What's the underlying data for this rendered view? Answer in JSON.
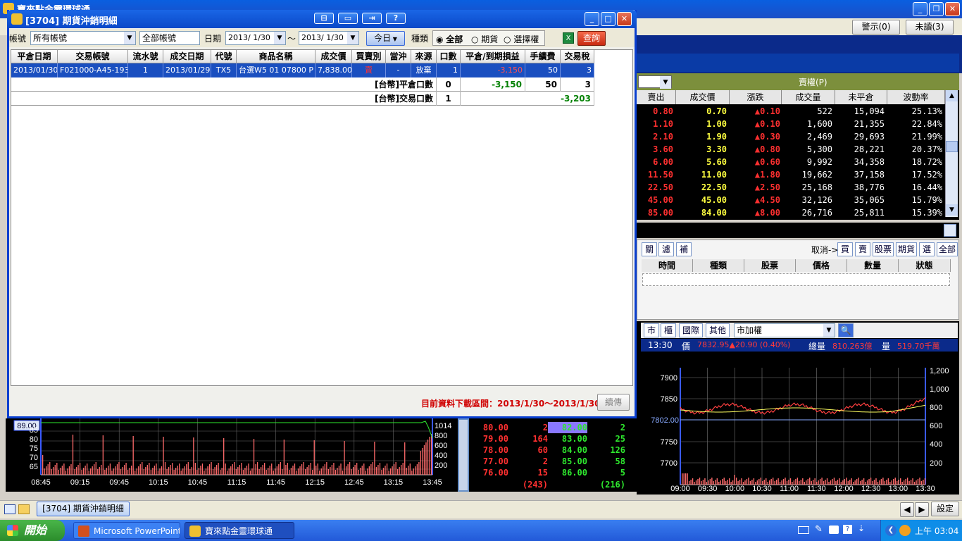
{
  "app": {
    "title": "寶來點金靈環球通"
  },
  "toolbar": {
    "alerts": "警示(0)",
    "unread": "未讀(3)"
  },
  "options": {
    "header": "賣權(P)",
    "columns": [
      "賣出",
      "成交價",
      "漲跌",
      "成交量",
      "未平倉",
      "波動率"
    ],
    "rows": [
      [
        "0.80",
        "0.70",
        "▲0.10",
        "522",
        "15,094",
        "25.13%"
      ],
      [
        "1.10",
        "1.00",
        "▲0.10",
        "1,600",
        "21,355",
        "22.84%"
      ],
      [
        "2.10",
        "1.90",
        "▲0.30",
        "2,469",
        "29,693",
        "21.99%"
      ],
      [
        "3.60",
        "3.30",
        "▲0.80",
        "5,300",
        "28,221",
        "20.37%"
      ],
      [
        "6.00",
        "5.60",
        "▲0.60",
        "9,992",
        "34,358",
        "18.72%"
      ],
      [
        "11.50",
        "11.00",
        "▲1.80",
        "19,662",
        "37,158",
        "17.52%"
      ],
      [
        "22.50",
        "22.50",
        "▲2.50",
        "25,168",
        "38,776",
        "16.44%"
      ],
      [
        "45.00",
        "45.00",
        "▲4.50",
        "32,126",
        "35,065",
        "15.79%"
      ],
      [
        "85.00",
        "84.00",
        "▲8.00",
        "26,716",
        "25,811",
        "15.39%"
      ]
    ]
  },
  "orders": {
    "buttons_left": [
      "關",
      "濾",
      "補"
    ],
    "cancel_label": "取消->",
    "buttons_right": [
      "買",
      "賣",
      "股票",
      "期貨",
      "選",
      "全部"
    ],
    "columns": [
      "時間",
      "種類",
      "股票",
      "價格",
      "數量",
      "狀態"
    ]
  },
  "index": {
    "tabs": [
      "市",
      "櫃",
      "國際",
      "其他"
    ],
    "market_select": "市加權",
    "time": "13:30",
    "price_label": "價",
    "price_value": "7832.95▲20.90 (0.40%)",
    "total_label": "總量",
    "total_value": "810.263億",
    "vol_label": "量",
    "vol_value": "519.70千萬",
    "y_ticks": [
      "7900",
      "7850",
      "7800",
      "7750",
      "7700"
    ],
    "ref_label": "7802.00",
    "vol_ticks": [
      "1,200",
      "1,000",
      "800",
      "600",
      "400",
      "200"
    ],
    "x_ticks": [
      "09:00",
      "09:30",
      "10:00",
      "10:30",
      "11:00",
      "11:30",
      "12:00",
      "12:30",
      "13:00",
      "13:30"
    ]
  },
  "left_chart": {
    "price_tag": "89.00",
    "y_ticks": [
      "85",
      "80",
      "75",
      "70",
      "65"
    ],
    "vol_ticks": [
      "1014",
      "800",
      "600",
      "400",
      "200"
    ],
    "x_ticks": [
      "08:45",
      "09:15",
      "09:45",
      "10:15",
      "10:45",
      "11:15",
      "11:45",
      "12:15",
      "12:45",
      "13:15",
      "13:45"
    ]
  },
  "orderbook": {
    "rows": [
      [
        "80.00",
        "2",
        "82.00",
        "2"
      ],
      [
        "79.00",
        "164",
        "83.00",
        "25"
      ],
      [
        "78.00",
        "60",
        "84.00",
        "126"
      ],
      [
        "77.00",
        "2",
        "85.00",
        "58"
      ],
      [
        "76.00",
        "15",
        "86.00",
        "5"
      ]
    ],
    "bid_total": "(243)",
    "ask_total": "(216)"
  },
  "dialog": {
    "title": "[3704] 期貨沖銷明細",
    "account_label": "帳號",
    "account_value": "所有帳號",
    "subaccount_value": "全部帳號",
    "date_label": "日期",
    "date_from": "2013/ 1/30",
    "date_sep": "～",
    "date_to": "2013/ 1/30",
    "today_button": "今日",
    "kind_label": "種類",
    "kind_options": [
      "全部",
      "期貨",
      "選擇權"
    ],
    "query_button": "查詢",
    "columns": [
      "平倉日期",
      "交易帳號",
      "流水號",
      "成交日期",
      "代號",
      "商品名稱",
      "成交價",
      "買賣別",
      "當沖",
      "來源",
      "口數",
      "平倉/到期損益",
      "手續費",
      "交易稅"
    ],
    "row": [
      "2013/01/30",
      "F021000-A45-1939915",
      "1",
      "2013/01/29",
      "TX5",
      "台選W5 01 07800 P",
      "7,838.00",
      "賣",
      "-",
      "放棄",
      "1",
      "-3,150",
      "50",
      "3"
    ],
    "summary1": {
      "label": "[台幣]平倉口數",
      "qty": "0",
      "pnl": "-3,150",
      "fee": "50",
      "tax": "3"
    },
    "summary2": {
      "label": "[台幣]交易口數",
      "qty": "1",
      "net": "-3,203"
    },
    "range_text": "目前資料下載區間：2013/1/30～2013/1/30",
    "continue_button": "續傳"
  },
  "tray_bar": {
    "window_tab": "[3704] 期貨沖銷明細",
    "settings": "設定"
  },
  "taskbar": {
    "start": "開始",
    "tasks": [
      "Microsoft PowerPoint ...",
      "寶來點金靈環球通"
    ],
    "clock": "上午 03:04"
  }
}
